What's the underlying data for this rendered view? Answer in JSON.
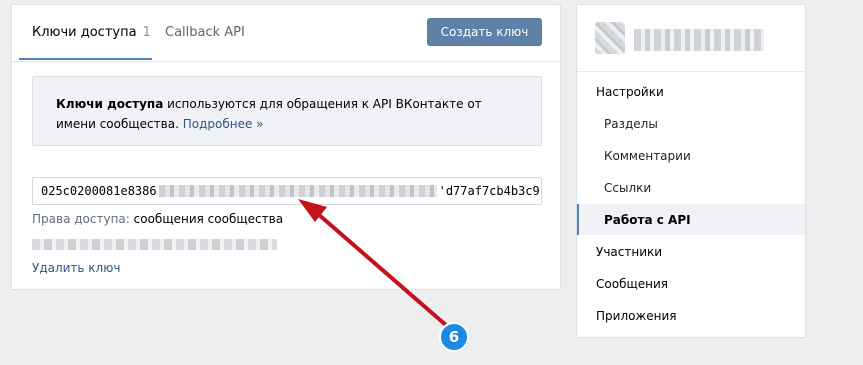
{
  "tabs": {
    "keys_label": "Ключи доступа",
    "keys_count": "1",
    "callback_label": "Callback API"
  },
  "create_button": "Создать ключ",
  "info": {
    "bold": "Ключи доступа",
    "text": " используются для обращения к API ВКонтакте от имени сообщества.",
    "link": "Подробнее »"
  },
  "key": {
    "prefix": "025c0200081e8386",
    "suffix": "'d77af7cb4b3c9"
  },
  "rights": {
    "label": "Права доступа:",
    "value": "сообщения сообщества"
  },
  "delete_link": "Удалить ключ",
  "sidebar": {
    "items": [
      {
        "label": "Настройки"
      },
      {
        "label": "Разделы"
      },
      {
        "label": "Комментарии"
      },
      {
        "label": "Ссылки"
      },
      {
        "label": "Работа с API"
      },
      {
        "label": "Участники"
      },
      {
        "label": "Сообщения"
      },
      {
        "label": "Приложения"
      }
    ]
  },
  "annotation": {
    "number": "6",
    "arrow_color": "#c4121b",
    "badge_color": "#1e88e5"
  }
}
